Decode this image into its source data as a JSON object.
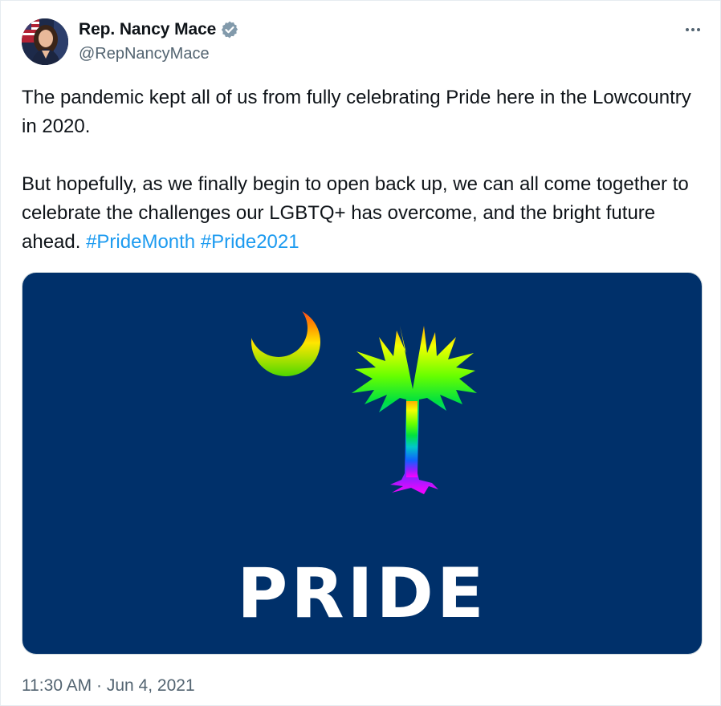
{
  "author": {
    "display_name": "Rep. Nancy Mace",
    "handle": "@RepNancyMace",
    "verified_icon": "verified-badge-icon",
    "verified_color": "#829aab"
  },
  "tweet": {
    "paragraph1": "The pandemic kept all of us from fully celebrating Pride here in the Lowcountry in 2020.",
    "paragraph2_text": "But hopefully, as we finally begin to open back up, we can all come together to celebrate the challenges our LGBTQ+ has overcome, and the bright future ahead. ",
    "hashtags": [
      "#PrideMonth",
      "#Pride2021"
    ],
    "time": "11:30 AM",
    "separator": "·",
    "date": "Jun 4, 2021"
  },
  "media": {
    "background_color": "#00306a",
    "overlay_text": "PRIDE",
    "icons": [
      "crescent-moon-icon",
      "palmetto-tree-icon"
    ]
  },
  "colors": {
    "hashtag": "#1d9bf0",
    "secondary_text": "#536471"
  }
}
